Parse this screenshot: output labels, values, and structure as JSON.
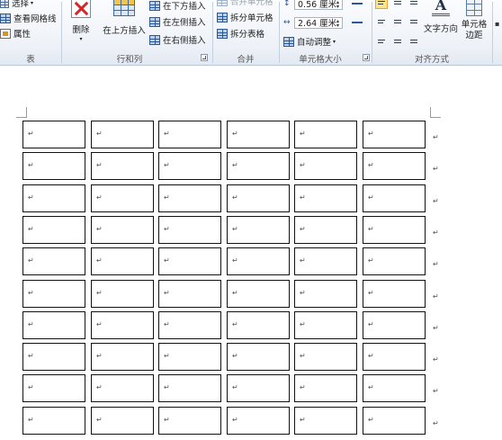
{
  "ribbon": {
    "table_group": {
      "select_label": "选择",
      "gridlines_label": "查看网格线",
      "properties_label": "属性",
      "group_label": "表"
    },
    "rows_cols_group": {
      "delete_label": "删除",
      "insert_above_label": "在上方插入",
      "insert_below_label": "在下方插入",
      "insert_left_label": "在左侧插入",
      "insert_right_label": "在右侧插入",
      "group_label": "行和列"
    },
    "merge_group": {
      "merge_cells_label": "合并单元格",
      "split_cells_label": "拆分单元格",
      "split_table_label": "拆分表格",
      "group_label": "合并"
    },
    "cell_size_group": {
      "height_value": "0.56 厘米",
      "width_value": "2.64 厘米",
      "autofit_label": "自动调整",
      "group_label": "单元格大小"
    },
    "alignment_group": {
      "text_direction_label": "文字方向",
      "cell_margins_label": "单元格边距",
      "group_label": "对齐方式",
      "selected_alignment": "top-left"
    }
  },
  "document": {
    "cell_mark": "↵",
    "row_end_mark": "↵",
    "rows": 10,
    "columns": 6
  },
  "colors": {
    "ribbon_bg": "#eef2f8",
    "selected_alignment": "#fde58e",
    "cell_border": "#111111"
  }
}
